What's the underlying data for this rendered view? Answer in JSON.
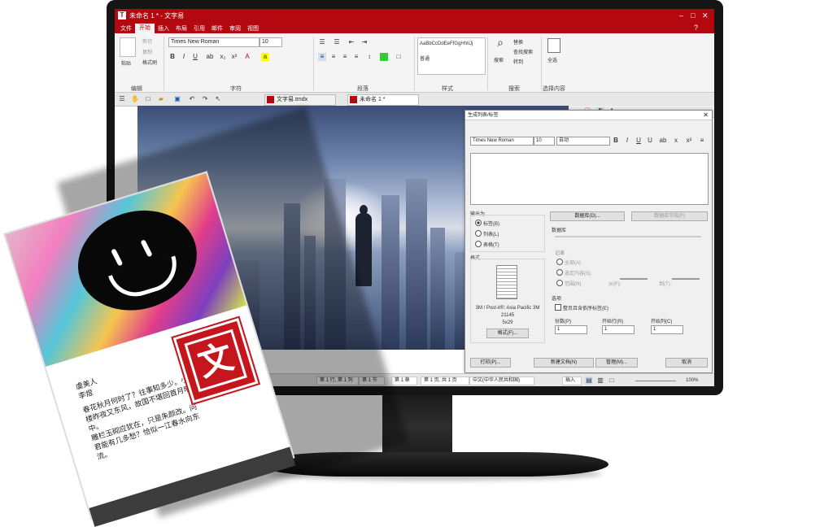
{
  "window": {
    "title": "未命名 1 * - 文字易",
    "controls": [
      "–",
      "□",
      "✕"
    ],
    "help": "?"
  },
  "ribbon_tabs": [
    "文件",
    "开始",
    "插入",
    "布局",
    "引用",
    "邮件",
    "审阅",
    "视图"
  ],
  "active_tab": "开始",
  "clipboard": {
    "paste": "粘贴",
    "cut": "剪切",
    "copy": "复制",
    "format_painter": "格式刷",
    "label": "编辑"
  },
  "font": {
    "name": "Times New Roman",
    "size": "10",
    "label": "字符"
  },
  "paragraph": {
    "label": "段落"
  },
  "styles": {
    "style1": "AaBbCcDdEeFfGgHhIiJj",
    "style2": "普通",
    "label": "样式"
  },
  "search": {
    "search": "搜索",
    "replace": "替换",
    "find_replace": "查找搜索",
    "goto": "转到",
    "label": "搜索"
  },
  "select": {
    "select": "全选",
    "label": "选择内容"
  },
  "doc_tabs": [
    "文字易.tmdx",
    "未命名 1 *"
  ],
  "dialog": {
    "title": "生成列表/标签",
    "font_name": "Times New Roman",
    "font_size": "10",
    "color": "自动",
    "output_label": "输出为",
    "output_options": [
      "标签(B)",
      "列表(L)",
      "表格(T)"
    ],
    "db_button": "数据库(D)...",
    "db_field_button": "数据库字段(F)",
    "db_label": "数据库",
    "records_label": "记录",
    "record_options": [
      "全部(A)",
      "选定内容(S)",
      "范围(R)"
    ],
    "from": "从(F):",
    "to": "到(T):",
    "format_label": "格式",
    "format_desc": [
      "3M / Post-it®: Asia Pacific 3M",
      "21145",
      "5x29"
    ],
    "format_button": "格式(F)...",
    "options_label": "选项",
    "skip_empty": "整页且含依序标签(E)",
    "copies": "份数(P)",
    "start_row": "开始行(R)",
    "start_col": "开始列(C)",
    "spin_values": [
      "1",
      "1",
      "1"
    ],
    "buttons": [
      "打印(P)...",
      "新建文档(N)",
      "管理(M)...",
      "取消"
    ]
  },
  "statusbar": {
    "items": [
      "第 1 行, 第 1 列",
      "第 1 节",
      "第 1 章",
      "第 1 页, 共 1 页",
      "中文(中华人民共和国)",
      "插入"
    ],
    "zoom": "100%"
  },
  "book": {
    "poem_lines": [
      "虞美人",
      "李煜",
      "春花秋月何时了？往事知多少。小楼昨夜又东风，故国不堪回首月明中。",
      "雕栏玉砌应犹在，只是朱颜改。问君能有几多愁？恰似一江春水向东流。"
    ],
    "logo_char": "文"
  }
}
